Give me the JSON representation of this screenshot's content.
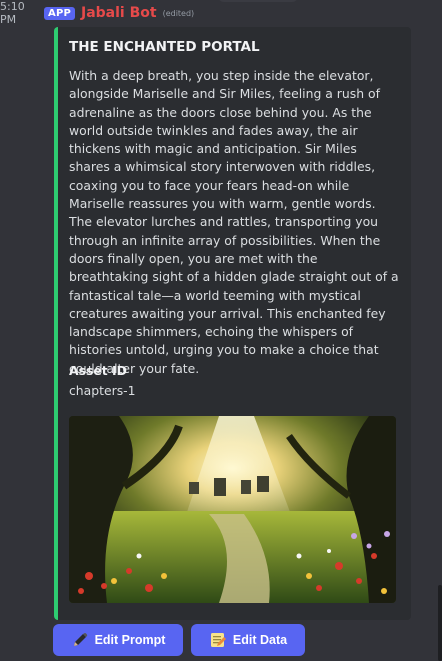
{
  "message": {
    "timestamp": "5:10 PM",
    "app_badge": "APP",
    "author": "Jabali Bot",
    "edited_label": "(edited)"
  },
  "embed": {
    "accent_color": "#2ecc71",
    "title": "THE ENCHANTED PORTAL",
    "description": "With a deep breath, you step inside the elevator, alongside Mariselle and Sir Miles, feeling a rush of adrenaline as the doors close behind you. As the world outside twinkles and fades away, the air thickens with magic and anticipation. Sir Miles shares a whimsical story interwoven with riddles, coaxing you to face your fears head-on while Mariselle reassures you with warm, gentle words. The elevator lurches and rattles, transporting you through an infinite array of possibilities. When the doors finally open, you are met with the breathtaking sight of a hidden glade straight out of a fantastical tale—a world teeming with mystical creatures awaiting your arrival. This enchanted fey landscape shimmers, echoing the whispers of histories untold, urging you to make a choice that could alter your fate.",
    "field": {
      "name": "Asset ID",
      "value": "chapters-1"
    }
  },
  "buttons": [
    {
      "label": "Edit Prompt",
      "icon": "pencil-icon"
    },
    {
      "label": "Edit Data",
      "icon": "memo-icon"
    }
  ],
  "colors": {
    "background": "#323339",
    "embed_background": "#2b2d31",
    "button": "#5865f2",
    "author": "#e64a4a",
    "badge": "#5865f2"
  }
}
